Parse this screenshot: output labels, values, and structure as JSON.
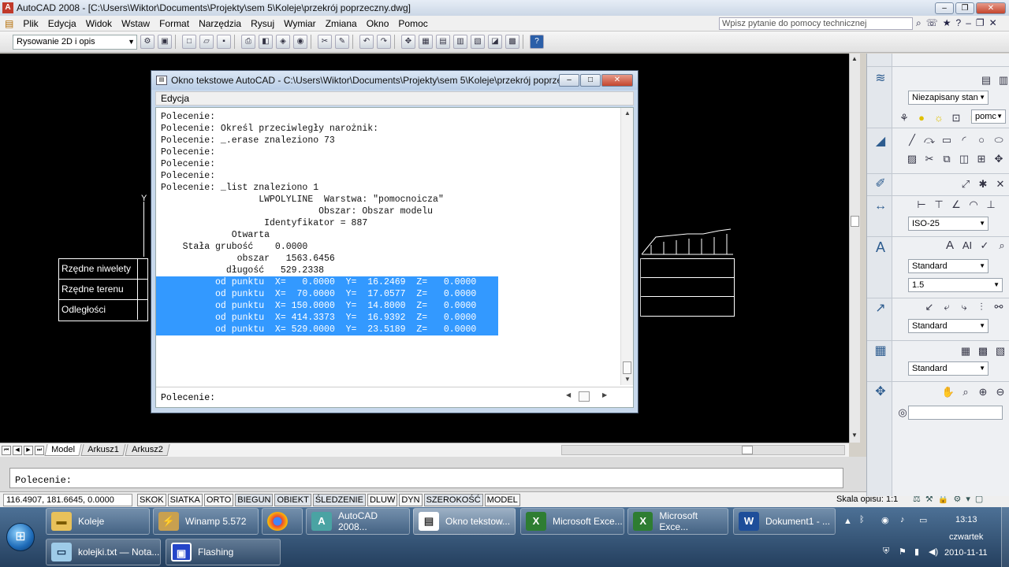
{
  "app": {
    "title": "AutoCAD 2008 - [C:\\Users\\Wiktor\\Documents\\Projekty\\sem 5\\Koleje\\przekrój poprzeczny.dwg]"
  },
  "menubar": {
    "items": [
      "Plik",
      "Edycja",
      "Widok",
      "Wstaw",
      "Format",
      "Narzędzia",
      "Rysuj",
      "Wymiar",
      "Zmiana",
      "Okno",
      "Pomoc"
    ],
    "help_placeholder": "Wpisz pytanie do pomocy technicznej"
  },
  "toolbar": {
    "workspace": "Rysowanie 2D i opis"
  },
  "drawing": {
    "y_axis_label": "Y",
    "table_rows": [
      "Rzędne niwelety",
      "Rzędne terenu",
      "Odległości"
    ]
  },
  "layout_tabs": [
    "Model",
    "Arkusz1",
    "Arkusz2"
  ],
  "command_line": {
    "text": "Polecenie:"
  },
  "status": {
    "coords": "116.4907, 181.6645, 0.0000",
    "toggles": [
      "SKOK",
      "SIATKA",
      "ORTO",
      "BIEGUN",
      "OBIEKT",
      "ŚLEDZENIE",
      "DLUW",
      "DYN",
      "SZEROKOŚĆ",
      "MODEL"
    ],
    "scale_label": "Skala opisu:",
    "scale_value": "1:1"
  },
  "palette": {
    "layer_state": "Niezapisany stan",
    "layer_name": "pomc",
    "dim_style": "ISO-25",
    "text_style": "Standard",
    "text_height": "1.5",
    "mleader_style": "Standard",
    "table_style": "Standard"
  },
  "text_window": {
    "title": "Okno tekstowe AutoCAD - C:\\Users\\Wiktor\\Documents\\Projekty\\sem 5\\Koleje\\przekrój poprzecz...",
    "menu": "Edycja",
    "lines": [
      "Polecenie:",
      "Polecenie: Określ przeciwległy narożnik:",
      "Polecenie: _.erase znaleziono 73",
      "",
      "Polecenie:",
      "Polecenie:",
      "Polecenie:",
      "Polecenie: _list znaleziono 1",
      "",
      "                  LWPOLYLINE  Warstwa: \"pomocnoicza\"",
      "                             Obszar: Obszar modelu",
      "                   Identyfikator = 887",
      "             Otwarta",
      "    Stała grubość    0.0000",
      "              obszar   1563.6456",
      "            długość   529.2338",
      ""
    ],
    "highlighted_lines": [
      "od punktu  X=   0.0000  Y=  16.2469  Z=   0.0000",
      "od punktu  X=  70.0000  Y=  17.0577  Z=   0.0000",
      "od punktu  X= 150.0000  Y=  14.8000  Z=   0.0000",
      "od punktu  X= 414.3373  Y=  16.9392  Z=   0.0000",
      "od punktu  X= 529.0000  Y=  23.5189  Z=   0.0000"
    ],
    "highlight_indent": "          ",
    "prompt": "Polecenie:"
  },
  "taskbar": {
    "row1": [
      {
        "label": "Koleje",
        "icon": "folder-icon"
      },
      {
        "label": "Winamp 5.572",
        "icon": "winamp-icon"
      },
      {
        "label": "",
        "icon": "chrome-icon"
      },
      {
        "label": "AutoCAD 2008...",
        "icon": "autocad-icon"
      },
      {
        "label": "Okno tekstow...",
        "icon": "text-window-icon"
      },
      {
        "label": "Microsoft Exce...",
        "icon": "excel-icon"
      },
      {
        "label": "Microsoft Exce...",
        "icon": "excel-icon"
      },
      {
        "label": "Dokument1 - ...",
        "icon": "word-icon"
      }
    ],
    "row2": [
      {
        "label": "kolejki.txt — Nota...",
        "icon": "notepad-icon"
      },
      {
        "label": "Flashing",
        "icon": "flashing-icon"
      }
    ],
    "clock_time": "13:13",
    "clock_day": "czwartek",
    "clock_date": "2010-11-11"
  }
}
